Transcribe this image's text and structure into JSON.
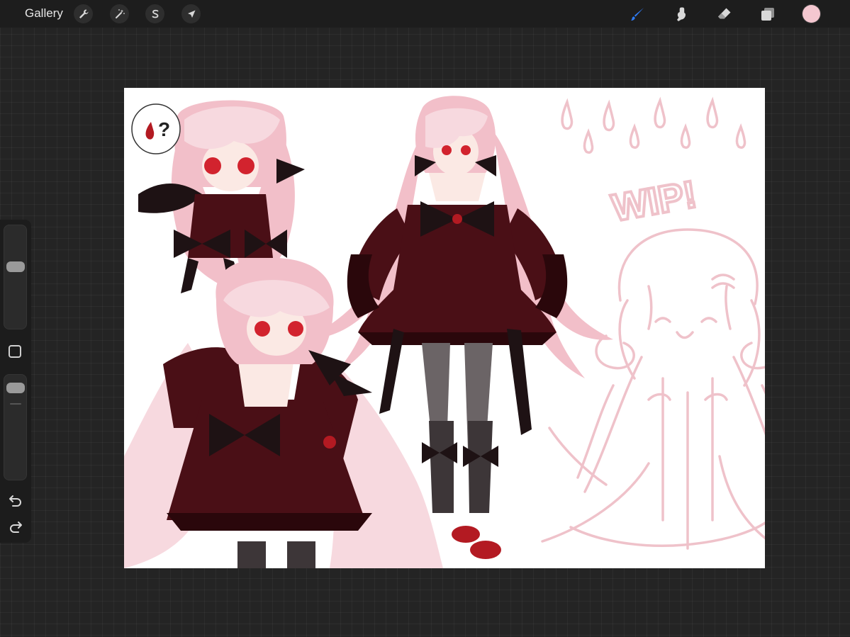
{
  "app": {
    "gallery_label": "Gallery"
  },
  "toolbar": {
    "left_tools": [
      {
        "name": "actions",
        "icon": "wrench-icon"
      },
      {
        "name": "adjustments",
        "icon": "magic-wand-icon"
      },
      {
        "name": "selection",
        "icon": "selection-s-icon"
      },
      {
        "name": "transform",
        "icon": "arrow-cursor-icon"
      }
    ],
    "right_tools": [
      {
        "name": "brush",
        "icon": "brush-icon",
        "active": true
      },
      {
        "name": "smudge",
        "icon": "smudge-finger-icon",
        "active": false
      },
      {
        "name": "eraser",
        "icon": "eraser-icon",
        "active": false
      },
      {
        "name": "layers",
        "icon": "layers-icon",
        "active": false
      }
    ],
    "current_color": "#f4c7d0"
  },
  "sidebar": {
    "brush_size_level": 0.62,
    "opacity_level": 0.94
  },
  "canvas": {
    "artwork_text": "WIP!",
    "palette": {
      "hair": "#f2bfc9",
      "hair_light": "#f7d9df",
      "dress": "#4a0f16",
      "dress_dark": "#2a070b",
      "ribbon": "#1e1214",
      "stocking": "#6b6466",
      "shoe": "#b31a22",
      "sketch": "#efc2ca",
      "eye": "#d2232e"
    }
  },
  "colors": {
    "accent": "#2f7cf6",
    "icon": "#d8d8d8"
  }
}
